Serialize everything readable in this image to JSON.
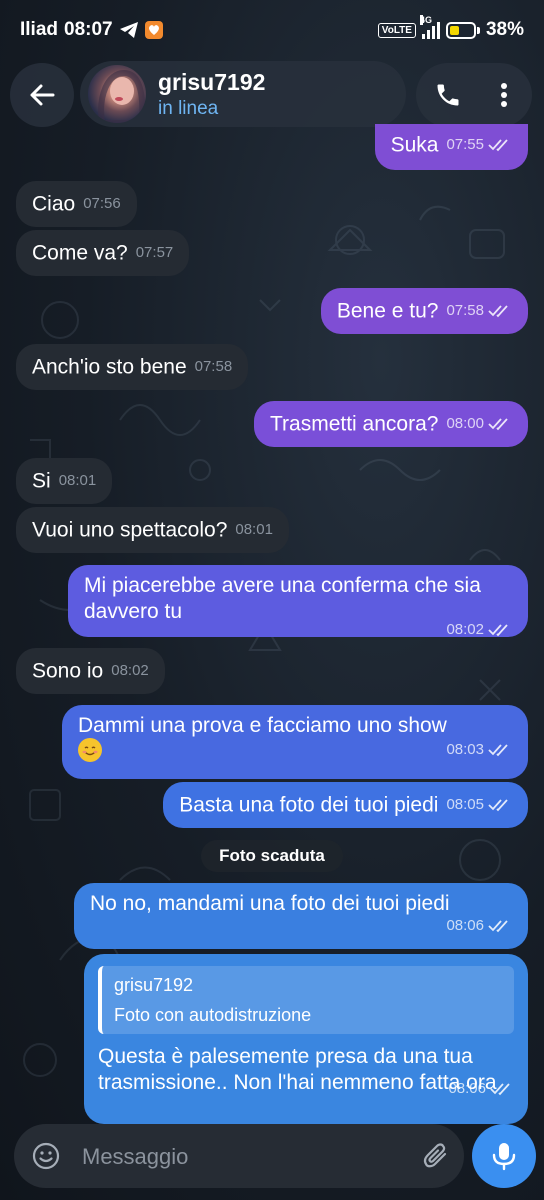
{
  "status_bar": {
    "carrier": "Iliad",
    "time": "08:07",
    "volte": "VoLTE",
    "network": "4G",
    "battery": "38%",
    "battery_level": 0.38
  },
  "header": {
    "name": "grisu7192",
    "status": "in linea"
  },
  "colors": {
    "out_purple": "#7f4ed4",
    "out_blue": "#3a7fe0",
    "incoming": "#252b33",
    "accent": "#3a8ff0"
  },
  "messages": [
    {
      "dir": "out",
      "text": "Suka",
      "time": "07:55"
    },
    {
      "dir": "in",
      "text": "Ciao",
      "time": "07:56"
    },
    {
      "dir": "in",
      "text": "Come va?",
      "time": "07:57"
    },
    {
      "dir": "out",
      "text": "Bene e tu?",
      "time": "07:58"
    },
    {
      "dir": "in",
      "text": "Anch'io sto bene",
      "time": "07:58"
    },
    {
      "dir": "out",
      "text": "Trasmetti ancora?",
      "time": "08:00"
    },
    {
      "dir": "in",
      "text": "Si",
      "time": "08:01"
    },
    {
      "dir": "in",
      "text": "Vuoi uno spettacolo?",
      "time": "08:01"
    },
    {
      "dir": "out",
      "text": "Mi piacerebbe avere una conferma che sia davvero tu",
      "time": "08:02"
    },
    {
      "dir": "in",
      "text": "Sono io",
      "time": "08:02"
    },
    {
      "dir": "out",
      "text": "Dammi una prova e facciamo uno show",
      "emoji": "smiling-face-emoji",
      "time": "08:03"
    },
    {
      "dir": "out",
      "text": "Basta una foto dei tuoi piedi",
      "time": "08:05"
    },
    {
      "dir": "system",
      "text": "Foto scaduta"
    },
    {
      "dir": "out",
      "text": "No no, mandami una foto dei tuoi piedi",
      "time": "08:06"
    },
    {
      "dir": "out",
      "reply_to": {
        "name": "grisu7192",
        "text": "Foto con autodistruzione"
      },
      "text": "Questa è palesemente presa da una tua trasmissione.. Non l'hai nemmeno fatta ora",
      "time": "08:06"
    }
  ],
  "composer": {
    "placeholder": "Messaggio"
  }
}
